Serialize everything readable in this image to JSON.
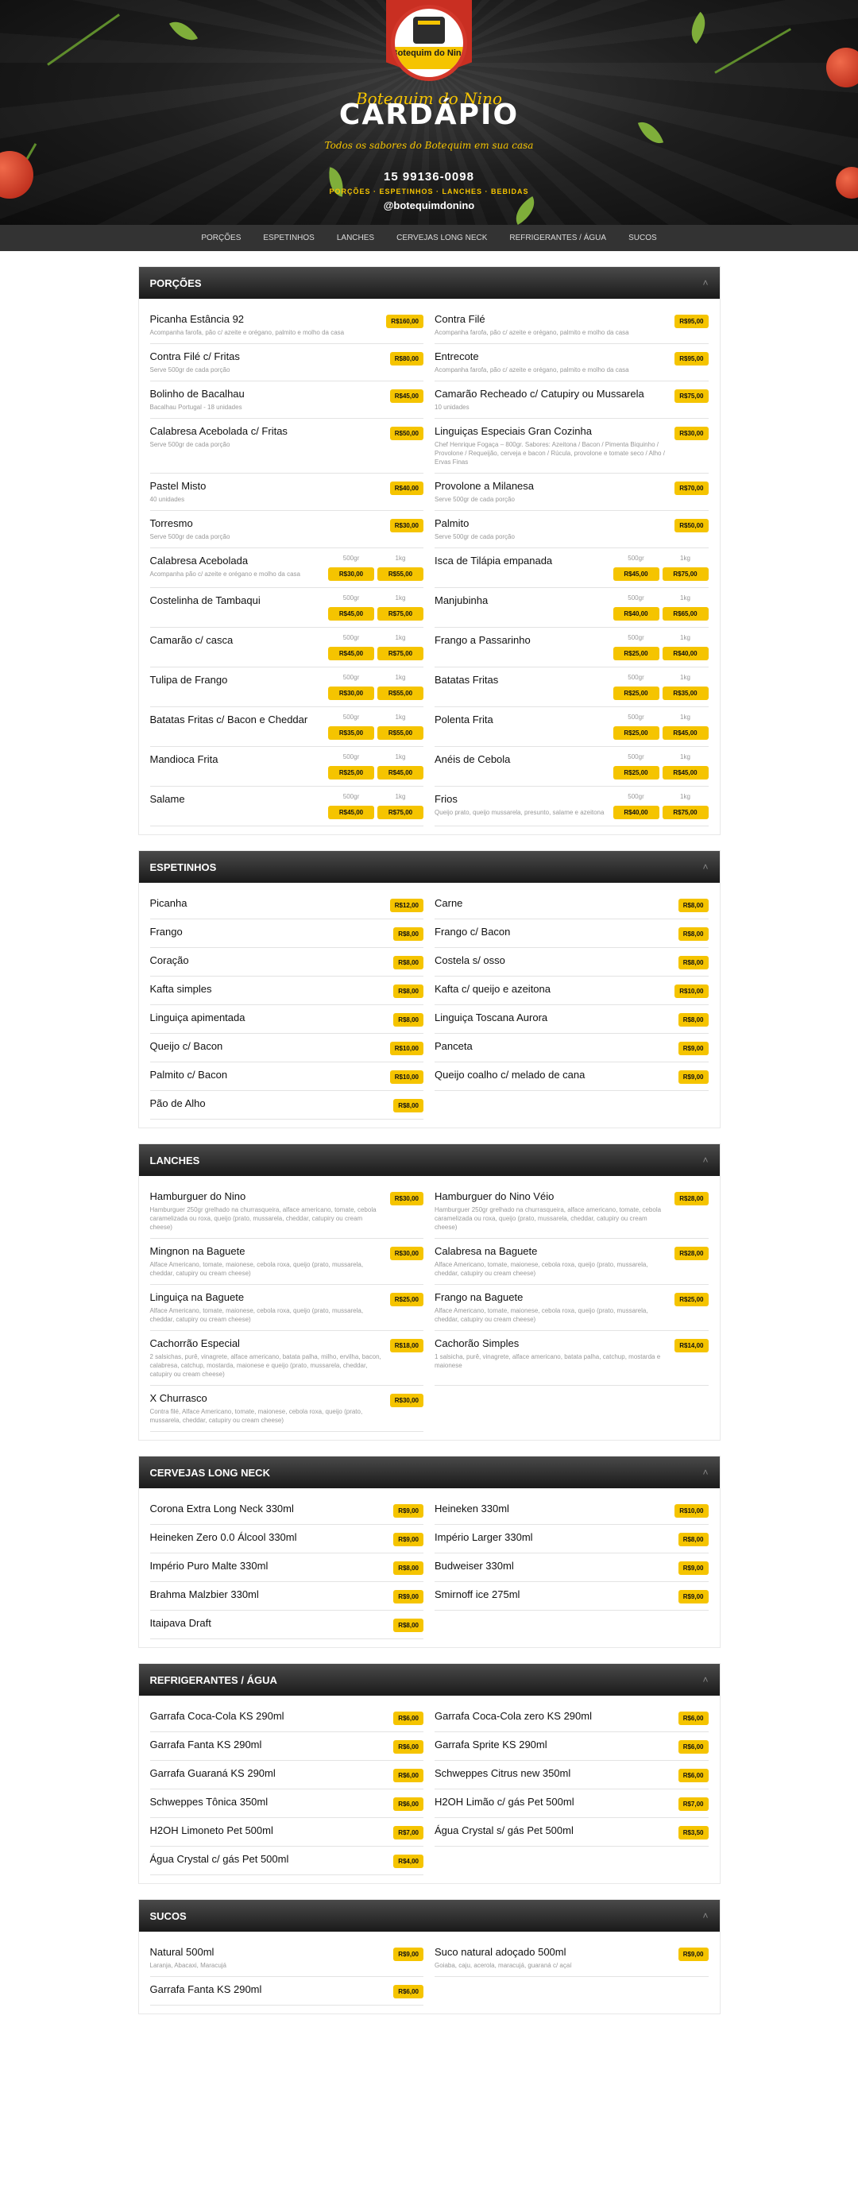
{
  "header": {
    "logo_text": "Botequim do Nino",
    "script_title": "Botequim do Nino",
    "title": "CARDÁPIO",
    "tagline": "Todos os sabores do Botequim em sua casa",
    "phone": "15 99136-0098",
    "categories_line": "PORÇÕES · ESPETINHOS · LANCHES · BEBIDAS",
    "instagram": "@botequimdonino"
  },
  "nav": [
    "PORÇÕES",
    "ESPETINHOS",
    "LANCHES",
    "CERVEJAS LONG NECK",
    "REFRIGERANTES / ÁGUA",
    "SUCOS"
  ],
  "colors": {
    "accent": "#f5c400",
    "brand_red": "#c92f22",
    "header_dark": "#1a1a1a",
    "nav": "#333333"
  },
  "sections": [
    {
      "title": "PORÇÕES",
      "items": [
        {
          "name": "Picanha Estância 92",
          "desc": "Acompanha farofa, pão c/ azeite e orégano, palmito e molho da casa",
          "prices": [
            "R$160,00"
          ]
        },
        {
          "name": "Contra Filé",
          "desc": "Acompanha farofa, pão c/ azeite e orégano, palmito e molho da casa",
          "prices": [
            "R$95,00"
          ]
        },
        {
          "name": "Contra Filé c/ Fritas",
          "desc": "Serve 500gr de cada porção",
          "prices": [
            "R$80,00"
          ]
        },
        {
          "name": "Entrecote",
          "desc": "Acompanha farofa, pão c/ azeite e orégano, palmito e molho da casa",
          "prices": [
            "R$95,00"
          ]
        },
        {
          "name": "Bolinho de Bacalhau",
          "desc": "Bacalhau Portugal - 18 unidades",
          "prices": [
            "R$45,00"
          ]
        },
        {
          "name": "Camarão Recheado c/ Catupiry ou Mussarela",
          "desc": "10 unidades",
          "prices": [
            "R$75,00"
          ]
        },
        {
          "name": "Calabresa Acebolada c/ Fritas",
          "desc": "Serve 500gr de cada porção",
          "prices": [
            "R$50,00"
          ]
        },
        {
          "name": "Linguiças Especiais Gran Cozinha",
          "desc": "Chef Henrique Fogaça – 800gr. Sabores: Azeitona / Bacon / Pimenta Biquinho / Provolone / Requeijão, cerveja e bacon / Rúcula, provolone e tomate seco / Alho / Ervas Finas",
          "prices": [
            "R$30,00"
          ]
        },
        {
          "name": "Pastel Misto",
          "desc": "40 unidades",
          "prices": [
            "R$40,00"
          ]
        },
        {
          "name": "Provolone a Milanesa",
          "desc": "Serve 500gr de cada porção",
          "prices": [
            "R$70,00"
          ]
        },
        {
          "name": "Torresmo",
          "desc": "Serve 500gr de cada porção",
          "prices": [
            "R$30,00"
          ]
        },
        {
          "name": "Palmito",
          "desc": "Serve 500gr de cada porção",
          "prices": [
            "R$50,00"
          ]
        },
        {
          "name": "Calabresa Acebolada",
          "desc": "Acompanha pão c/ azeite e orégano e molho da casa",
          "prices": [
            "R$30,00",
            "R$55,00"
          ]
        },
        {
          "name": "Isca de Tilápia empanada",
          "desc": "",
          "prices": [
            "R$45,00",
            "R$75,00"
          ]
        },
        {
          "name": "Costelinha de Tambaqui",
          "desc": "",
          "prices": [
            "R$45,00",
            "R$75,00"
          ]
        },
        {
          "name": "Manjubinha",
          "desc": "",
          "prices": [
            "R$40,00",
            "R$65,00"
          ]
        },
        {
          "name": "Camarão c/ casca",
          "desc": "",
          "prices": [
            "R$45,00",
            "R$75,00"
          ]
        },
        {
          "name": "Frango a Passarinho",
          "desc": "",
          "prices": [
            "R$25,00",
            "R$40,00"
          ]
        },
        {
          "name": "Tulipa de Frango",
          "desc": "",
          "prices": [
            "R$30,00",
            "R$55,00"
          ]
        },
        {
          "name": "Batatas Fritas",
          "desc": "",
          "prices": [
            "R$25,00",
            "R$35,00"
          ]
        },
        {
          "name": "Batatas Fritas c/ Bacon e Cheddar",
          "desc": "",
          "prices": [
            "R$35,00",
            "R$55,00"
          ]
        },
        {
          "name": "Polenta Frita",
          "desc": "",
          "prices": [
            "R$25,00",
            "R$45,00"
          ]
        },
        {
          "name": "Mandioca Frita",
          "desc": "",
          "prices": [
            "R$25,00",
            "R$45,00"
          ]
        },
        {
          "name": "Anéis de Cebola",
          "desc": "",
          "prices": [
            "R$25,00",
            "R$45,00"
          ]
        },
        {
          "name": "Salame",
          "desc": "",
          "prices": [
            "R$45,00",
            "R$75,00"
          ]
        },
        {
          "name": "Frios",
          "desc": "Queijo prato, queijo mussarela, presunto, salame e azeitona",
          "prices": [
            "R$40,00",
            "R$75,00"
          ]
        }
      ]
    },
    {
      "title": "ESPETINHOS",
      "items": [
        {
          "name": "Picanha",
          "desc": "",
          "prices": [
            "R$12,00"
          ]
        },
        {
          "name": "Carne",
          "desc": "",
          "prices": [
            "R$8,00"
          ]
        },
        {
          "name": "Frango",
          "desc": "",
          "prices": [
            "R$8,00"
          ]
        },
        {
          "name": "Frango c/ Bacon",
          "desc": "",
          "prices": [
            "R$8,00"
          ]
        },
        {
          "name": "Coração",
          "desc": "",
          "prices": [
            "R$8,00"
          ]
        },
        {
          "name": "Costela s/ osso",
          "desc": "",
          "prices": [
            "R$8,00"
          ]
        },
        {
          "name": "Kafta simples",
          "desc": "",
          "prices": [
            "R$8,00"
          ]
        },
        {
          "name": "Kafta c/ queijo e azeitona",
          "desc": "",
          "prices": [
            "R$10,00"
          ]
        },
        {
          "name": "Linguiça apimentada",
          "desc": "",
          "prices": [
            "R$8,00"
          ]
        },
        {
          "name": "Linguiça Toscana Aurora",
          "desc": "",
          "prices": [
            "R$8,00"
          ]
        },
        {
          "name": "Queijo c/ Bacon",
          "desc": "",
          "prices": [
            "R$10,00"
          ]
        },
        {
          "name": "Panceta",
          "desc": "",
          "prices": [
            "R$9,00"
          ]
        },
        {
          "name": "Palmito c/ Bacon",
          "desc": "",
          "prices": [
            "R$10,00"
          ]
        },
        {
          "name": "Queijo coalho c/ melado de cana",
          "desc": "",
          "prices": [
            "R$9,00"
          ]
        },
        {
          "name": "Pão de Alho",
          "desc": "",
          "prices": [
            "R$8,00"
          ]
        }
      ]
    },
    {
      "title": "LANCHES",
      "items": [
        {
          "name": "Hamburguer do Nino",
          "desc": "Hamburguer 250gr grelhado na churrasqueira, alface americano, tomate, cebola caramelizada ou roxa, queijo (prato, mussarela, cheddar, catupiry ou cream cheese)",
          "prices": [
            "R$30,00"
          ]
        },
        {
          "name": "Hamburguer do Nino Véio",
          "desc": "Hamburguer 250gr grelhado na churrasqueira, alface americano, tomate, cebola caramelizada ou roxa, queijo (prato, mussarela, cheddar, catupiry ou cream cheese)",
          "prices": [
            "R$28,00"
          ]
        },
        {
          "name": "Mingnon na Baguete",
          "desc": "Alface Americano, tomate, maionese, cebola roxa, queijo (prato, mussarela, cheddar, catupiry ou cream cheese)",
          "prices": [
            "R$30,00"
          ]
        },
        {
          "name": "Calabresa na Baguete",
          "desc": "Alface Americano, tomate, maionese, cebola roxa, queijo (prato, mussarela, cheddar, catupiry ou cream cheese)",
          "prices": [
            "R$28,00"
          ]
        },
        {
          "name": "Linguiça na Baguete",
          "desc": "Alface Americano, tomate, maionese, cebola roxa, queijo (prato, mussarela, cheddar, catupiry ou cream cheese)",
          "prices": [
            "R$25,00"
          ]
        },
        {
          "name": "Frango na Baguete",
          "desc": "Alface Americano, tomate, maionese, cebola roxa, queijo (prato, mussarela, cheddar, catupiry ou cream cheese)",
          "prices": [
            "R$25,00"
          ]
        },
        {
          "name": "Cachorrão Especial",
          "desc": "2 salsichas, purê, vinagrete, alface americano, batata palha, milho, ervilha, bacon, calabresa, catchup, mostarda, maionese e queijo (prato, mussarela, cheddar, catupiry ou cream cheese)",
          "prices": [
            "R$18,00"
          ]
        },
        {
          "name": "Cachorão Simples",
          "desc": "1 salsicha, purê, vinagrete, alface americano, batata palha, catchup, mostarda e maionese",
          "prices": [
            "R$14,00"
          ]
        },
        {
          "name": "X Churrasco",
          "desc": "Contra filé, Alface Americano, tomate, maionese, cebola roxa, queijo (prato, mussarela, cheddar, catupiry ou cream cheese)",
          "prices": [
            "R$30,00"
          ]
        }
      ]
    },
    {
      "title": "CERVEJAS LONG NECK",
      "items": [
        {
          "name": "Corona Extra Long Neck 330ml",
          "desc": "",
          "prices": [
            "R$9,00"
          ]
        },
        {
          "name": "Heineken 330ml",
          "desc": "",
          "prices": [
            "R$10,00"
          ]
        },
        {
          "name": "Heineken Zero 0.0 Álcool 330ml",
          "desc": "",
          "prices": [
            "R$9,00"
          ]
        },
        {
          "name": "Império Larger 330ml",
          "desc": "",
          "prices": [
            "R$8,00"
          ]
        },
        {
          "name": "Império Puro Malte 330ml",
          "desc": "",
          "prices": [
            "R$8,00"
          ]
        },
        {
          "name": "Budweiser 330ml",
          "desc": "",
          "prices": [
            "R$9,00"
          ]
        },
        {
          "name": "Brahma Malzbier 330ml",
          "desc": "",
          "prices": [
            "R$9,00"
          ]
        },
        {
          "name": "Smirnoff ice 275ml",
          "desc": "",
          "prices": [
            "R$9,00"
          ]
        },
        {
          "name": "Itaipava Draft",
          "desc": "",
          "prices": [
            "R$8,00"
          ]
        }
      ]
    },
    {
      "title": "REFRIGERANTES / ÁGUA",
      "items": [
        {
          "name": "Garrafa Coca-Cola KS 290ml",
          "desc": "",
          "prices": [
            "R$6,00"
          ]
        },
        {
          "name": "Garrafa Coca-Cola zero KS 290ml",
          "desc": "",
          "prices": [
            "R$6,00"
          ]
        },
        {
          "name": "Garrafa Fanta KS 290ml",
          "desc": "",
          "prices": [
            "R$6,00"
          ]
        },
        {
          "name": "Garrafa Sprite KS 290ml",
          "desc": "",
          "prices": [
            "R$6,00"
          ]
        },
        {
          "name": "Garrafa Guaraná KS 290ml",
          "desc": "",
          "prices": [
            "R$6,00"
          ]
        },
        {
          "name": "Schweppes Citrus new 350ml",
          "desc": "",
          "prices": [
            "R$6,00"
          ]
        },
        {
          "name": "Schweppes Tônica 350ml",
          "desc": "",
          "prices": [
            "R$6,00"
          ]
        },
        {
          "name": "H2OH Limão c/ gás Pet 500ml",
          "desc": "",
          "prices": [
            "R$7,00"
          ]
        },
        {
          "name": "H2OH Limoneto Pet 500ml",
          "desc": "",
          "prices": [
            "R$7,00"
          ]
        },
        {
          "name": "Água Crystal s/ gás Pet 500ml",
          "desc": "",
          "prices": [
            "R$3,50"
          ]
        },
        {
          "name": "Água Crystal c/ gás Pet 500ml",
          "desc": "",
          "prices": [
            "R$4,00"
          ]
        }
      ]
    },
    {
      "title": "SUCOS",
      "items": [
        {
          "name": "Natural 500ml",
          "desc": "Laranja, Abacaxi, Maracujá",
          "prices": [
            "R$9,00"
          ]
        },
        {
          "name": "Suco natural adoçado 500ml",
          "desc": "Goiaba, caju, acerola, maracujá, guaraná c/ açaí",
          "prices": [
            "R$9,00"
          ]
        },
        {
          "name": "Garrafa Fanta KS 290ml",
          "desc": "",
          "prices": [
            "R$6,00"
          ]
        }
      ]
    }
  ],
  "size_labels": [
    "500gr",
    "1kg"
  ]
}
